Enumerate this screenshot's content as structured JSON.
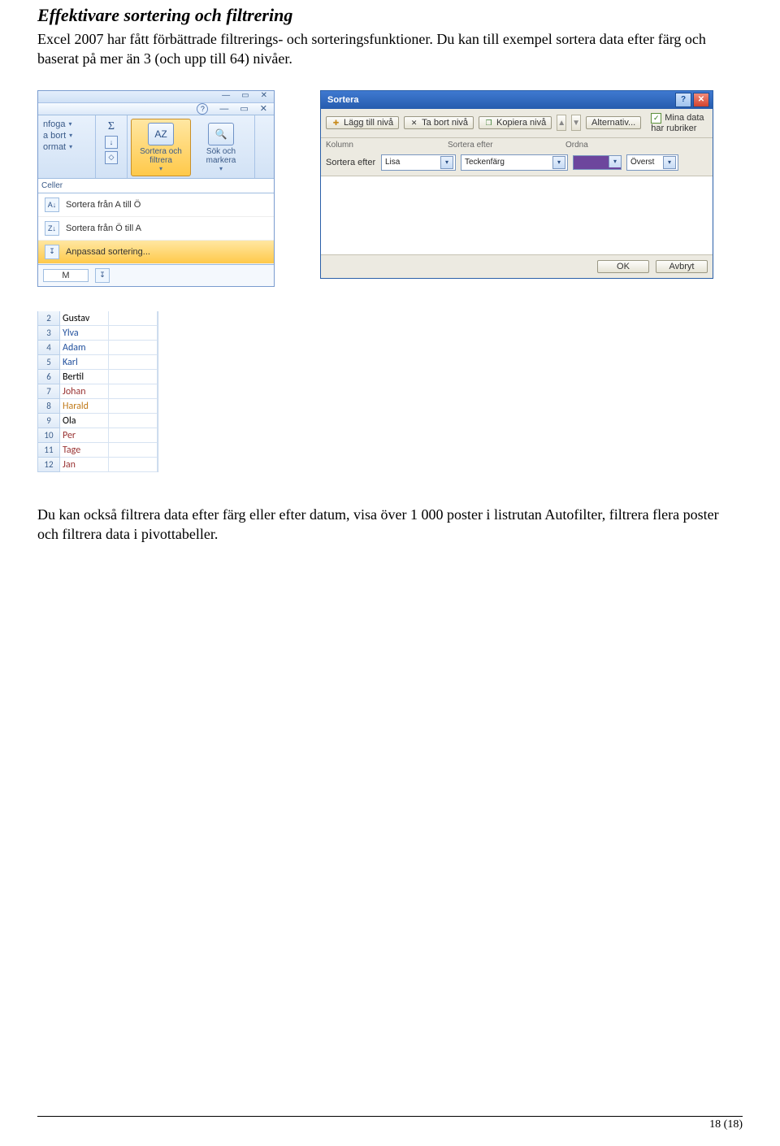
{
  "heading": "Effektivare sortering och filtrering",
  "para1": "Excel 2007 har fått förbättrade filtrerings- och sorteringsfunktioner. Du kan till exempel sortera data efter färg och baserat på mer än 3 (och upp till 64) nivåer.",
  "para2": "Du kan också filtrera data efter färg eller efter datum, visa över 1 000 poster i listrutan Autofilter, filtrera flera poster och filtrera data i pivottabeller.",
  "pageno": "18 (18)",
  "ribbon": {
    "sideButtons": [
      "nfoga",
      "a bort",
      "ormat"
    ],
    "cellsGroup": "Celler",
    "bigSort": "Sortera och filtrera",
    "bigFind": "Sök och markera",
    "menuAZ": "Sortera från A till Ö",
    "menuZA": "Sortera från Ö till A",
    "menuCustom": "Anpassad sortering...",
    "cellRef": "M"
  },
  "dialog": {
    "title": "Sortera",
    "addLevel": "Lägg till nivå",
    "delLevel": "Ta bort nivå",
    "copyLevel": "Kopiera nivå",
    "options": "Alternativ...",
    "hasHeaders": "Mina data har rubriker",
    "hKolumn": "Kolumn",
    "hSortEfter": "Sortera efter",
    "hOrdna": "Ordna",
    "rowLabel": "Sortera efter",
    "kolVal": "Lisa",
    "sortVal": "Teckenfärg",
    "ordVal": "Överst",
    "ok": "OK",
    "cancel": "Avbryt"
  },
  "sheet": {
    "rows": [
      {
        "n": "2",
        "v": "Gustav",
        "c": ""
      },
      {
        "n": "3",
        "v": "Ylva",
        "c": "b"
      },
      {
        "n": "4",
        "v": "Adam",
        "c": "b"
      },
      {
        "n": "5",
        "v": "Karl",
        "c": "b"
      },
      {
        "n": "6",
        "v": "Bertil",
        "c": ""
      },
      {
        "n": "7",
        "v": "Johan",
        "c": "r"
      },
      {
        "n": "8",
        "v": "Harald",
        "c": "o"
      },
      {
        "n": "9",
        "v": "Ola",
        "c": ""
      },
      {
        "n": "10",
        "v": "Per",
        "c": "r"
      },
      {
        "n": "11",
        "v": "Tage",
        "c": "r"
      },
      {
        "n": "12",
        "v": "Jan",
        "c": "r"
      }
    ]
  }
}
